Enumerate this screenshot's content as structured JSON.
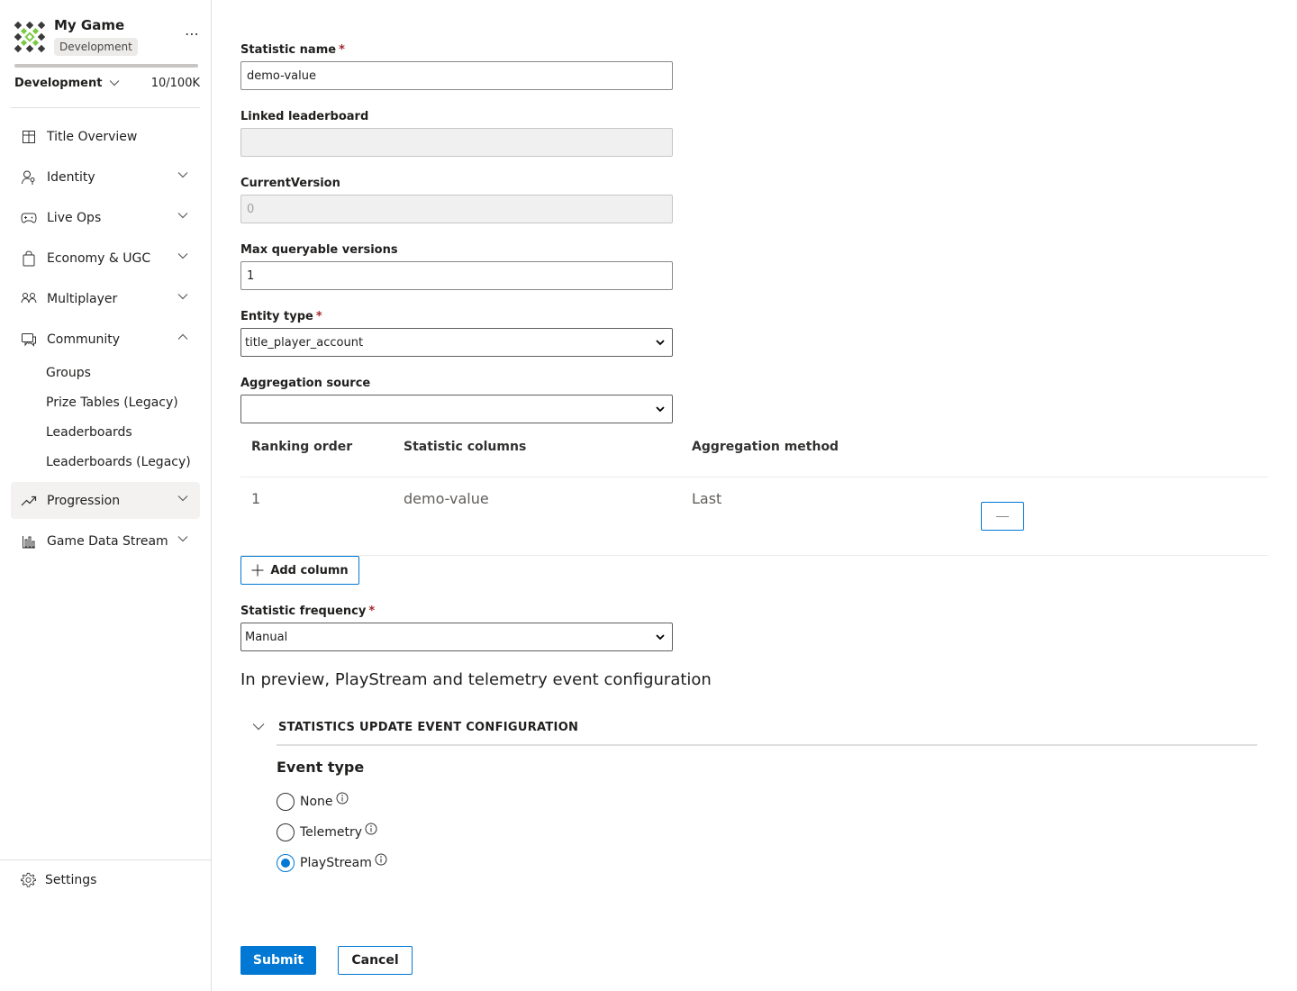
{
  "app": {
    "game_name": "My Game",
    "environment_badge": "Development",
    "environment_selector": "Development",
    "usage_count": "10/100K",
    "usage_fraction": 1.0
  },
  "sidebar": {
    "items": [
      {
        "label": "Title Overview",
        "icon": "grid-icon",
        "expandable": false
      },
      {
        "label": "Identity",
        "icon": "person-key-icon",
        "expandable": true
      },
      {
        "label": "Live Ops",
        "icon": "gamepad-icon",
        "expandable": true
      },
      {
        "label": "Economy & UGC",
        "icon": "shopping-bag-icon",
        "expandable": true
      },
      {
        "label": "Multiplayer",
        "icon": "people-icon",
        "expandable": true
      },
      {
        "label": "Community",
        "icon": "chat-icon",
        "expandable": true,
        "expanded": true
      },
      {
        "label": "Progression",
        "icon": "trending-icon",
        "expandable": true,
        "active": true
      },
      {
        "label": "Game Data Stream",
        "icon": "bar-chart-icon",
        "expandable": true
      }
    ],
    "community_children": [
      "Groups",
      "Prize Tables (Legacy)",
      "Leaderboards",
      "Leaderboards (Legacy)"
    ],
    "settings_label": "Settings"
  },
  "form": {
    "statistic_name": {
      "label": "Statistic name",
      "required": true,
      "value": "demo-value"
    },
    "linked_leaderboard": {
      "label": "Linked leaderboard",
      "value": ""
    },
    "current_version": {
      "label": "CurrentVersion",
      "value": "0"
    },
    "max_queryable_versions": {
      "label": "Max queryable versions",
      "value": "1"
    },
    "entity_type": {
      "label": "Entity type",
      "required": true,
      "value": "title_player_account"
    },
    "aggregation_source": {
      "label": "Aggregation source",
      "value": ""
    },
    "columns_table": {
      "headers": [
        "Ranking order",
        "Statistic columns",
        "Aggregation method"
      ],
      "rows": [
        {
          "ranking_order": "1",
          "statistic_column": "demo-value",
          "aggregation_method": "Last"
        }
      ]
    },
    "add_column_label": "Add column",
    "statistic_frequency": {
      "label": "Statistic frequency",
      "required": true,
      "value": "Manual"
    },
    "preview_heading": "In preview, PlayStream and telemetry event configuration",
    "accordion_title": "STATISTICS UPDATE EVENT CONFIGURATION",
    "event_type": {
      "title": "Event type",
      "options": [
        {
          "label": "None",
          "checked": false
        },
        {
          "label": "Telemetry",
          "checked": false
        },
        {
          "label": "PlayStream",
          "checked": true
        }
      ]
    },
    "submit_label": "Submit",
    "cancel_label": "Cancel"
  },
  "colors": {
    "accent": "#0078d4",
    "required": "#a4262c",
    "active_nav_bg": "#f3f2f1"
  }
}
